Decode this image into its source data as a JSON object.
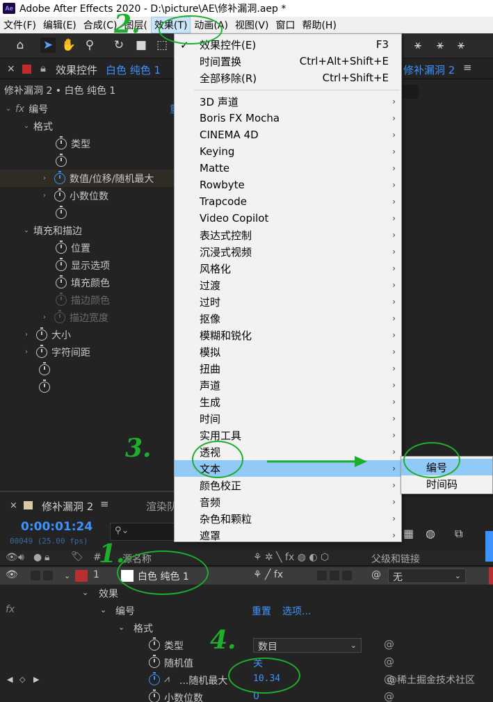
{
  "window": {
    "title": "Adobe After Effects 2020 - D:\\picture\\AE\\修补漏洞.aep *",
    "logo": "Ae"
  },
  "menubar": [
    {
      "label": "文件(F)"
    },
    {
      "label": "编辑(E)"
    },
    {
      "label": "合成(C)"
    },
    {
      "label": "图层("
    },
    {
      "label": "效果(T)",
      "active": true
    },
    {
      "label": "动画(A)"
    },
    {
      "label": "视图(V)"
    },
    {
      "label": "窗口"
    },
    {
      "label": "帮助(H)"
    }
  ],
  "effect_controls": {
    "tab_label": "效果控件",
    "tab_layer": "白色 纯色 1",
    "right_tab": "修补漏洞 2",
    "subtitle": "修补漏洞 2 • 白色 纯色 1",
    "rows": [
      {
        "label": "编号",
        "fx": true
      },
      {
        "label": "格式"
      },
      {
        "label": "类型"
      },
      {
        "label": ""
      },
      {
        "label": "数值/位移/随机最大"
      },
      {
        "label": "小数位数"
      },
      {
        "label": ""
      },
      {
        "label": "填充和描边"
      },
      {
        "label": "位置"
      },
      {
        "label": "显示选项"
      },
      {
        "label": "填充颜色"
      },
      {
        "label": "描边颜色"
      },
      {
        "label": "描边宽度"
      },
      {
        "label": "大小"
      },
      {
        "label": "字符间距"
      },
      {
        "label": ""
      },
      {
        "label": ""
      }
    ]
  },
  "effect_menu": {
    "top": [
      {
        "label": "效果控件(E)",
        "shortcut": "F3"
      },
      {
        "label": "时间置换",
        "shortcut": "Ctrl+Alt+Shift+E"
      },
      {
        "label": "全部移除(R)",
        "shortcut": "Ctrl+Shift+E"
      }
    ],
    "categories": [
      "3D 声道",
      "Boris FX Mocha",
      "CINEMA 4D",
      "Keying",
      "Matte",
      "Rowbyte",
      "Trapcode",
      "Video Copilot",
      "表达式控制",
      "沉浸式视频",
      "风格化",
      "过渡",
      "过时",
      "抠像",
      "模糊和锐化",
      "模拟",
      "扭曲",
      "声道",
      "生成",
      "时间",
      "实用工具",
      "透视",
      "文本",
      "颜色校正",
      "音频",
      "杂色和颗粒",
      "遮罩"
    ],
    "highlighted": "文本"
  },
  "submenu": {
    "items": [
      "编号",
      "时间码"
    ],
    "highlighted": "编号"
  },
  "timeline": {
    "tab_label": "修补漏洞 2",
    "tab_render": "渲染队",
    "timecode": "0:00:01:24",
    "frame_info": "00049 (25.00 fps)",
    "search_icon": "search-icon",
    "col_num": "#",
    "col_source": "源名称",
    "col_parent": "父级和链接",
    "layer": {
      "num": "1",
      "name": "白色 纯色 1",
      "parent": "无",
      "color": "#b82f2f"
    },
    "effects_label": "效果",
    "effect_name": "编号",
    "reset": "重置",
    "options": "选项...",
    "format": "格式",
    "type_label": "类型",
    "type_value": "数目",
    "random_label": "随机值",
    "random_value": "关",
    "max_label": "...随机最大",
    "max_value": "10.34",
    "decimals_label": "小数位数",
    "decimals_value": "0"
  },
  "annotations": {
    "n2": "2.",
    "n3": "3.",
    "n1": "1.",
    "n4": "4."
  },
  "watermark": "@稀土掘金技术社区",
  "colors": {
    "accent_blue": "#3c92ff",
    "menu_highlight": "#91c9f7",
    "annotation_green": "#1fae2c"
  }
}
